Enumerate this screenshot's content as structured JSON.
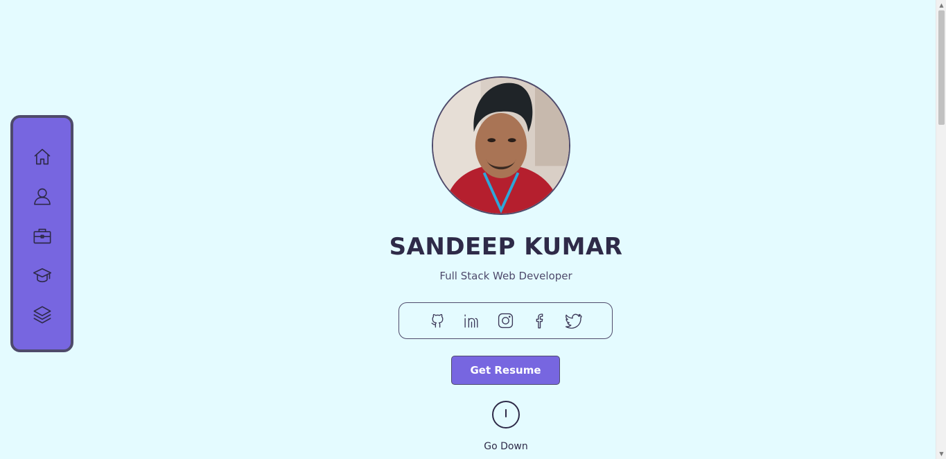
{
  "sidebar": {
    "items": [
      {
        "icon": "home-icon"
      },
      {
        "icon": "user-icon"
      },
      {
        "icon": "briefcase-icon"
      },
      {
        "icon": "graduation-cap-icon"
      },
      {
        "icon": "layers-icon"
      }
    ]
  },
  "hero": {
    "name": "SANDEEP KUMAR",
    "role": "Full Stack Web Developer",
    "resume_label": "Get Resume",
    "go_down_label": "Go Down"
  },
  "socials": [
    {
      "icon": "github-icon"
    },
    {
      "icon": "linkedin-icon"
    },
    {
      "icon": "instagram-icon"
    },
    {
      "icon": "facebook-icon"
    },
    {
      "icon": "twitter-icon"
    }
  ],
  "colors": {
    "background": "#e4fbff",
    "accent": "#7766e0",
    "text": "#2e2a48",
    "border": "#4e4a6b"
  }
}
